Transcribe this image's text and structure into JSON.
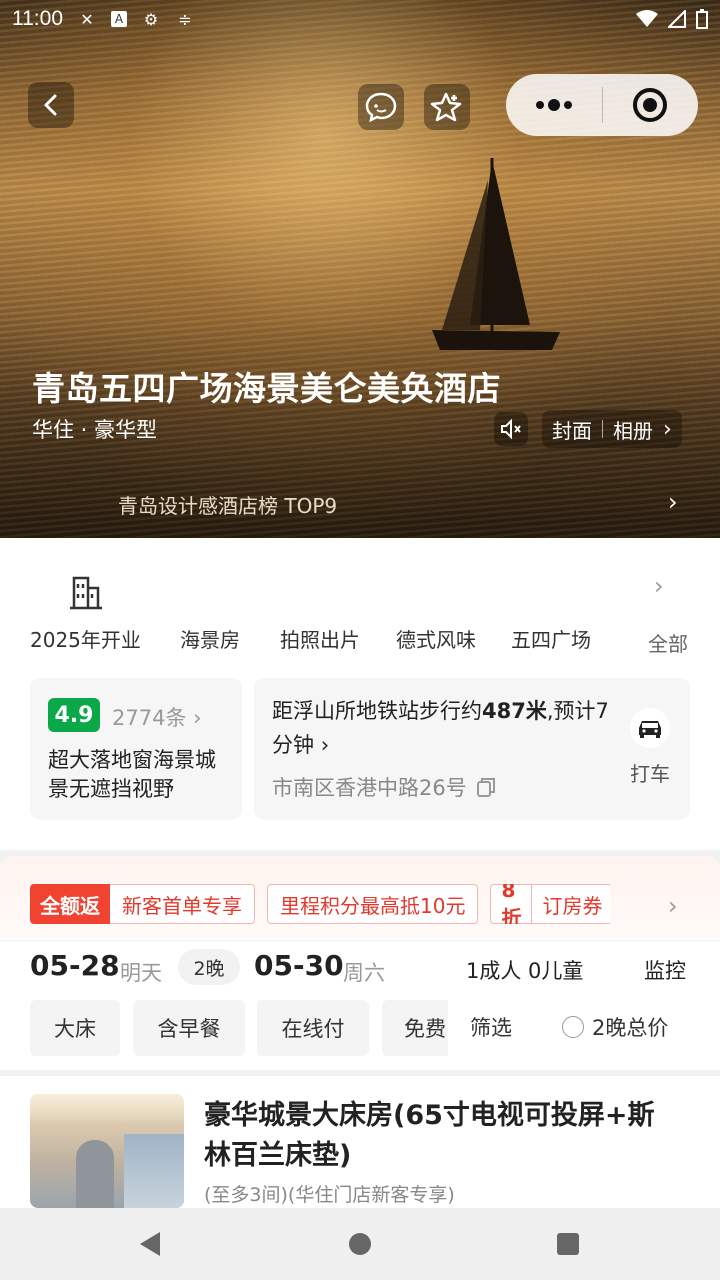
{
  "status_bar": {
    "time": "11:00"
  },
  "hero": {
    "hotel_name": "青岛五四广场海景美仑美奂酒店",
    "brand_type": "华住 · 豪华型",
    "cover_label": "封面",
    "album_label": "相册",
    "ranking_text": "青岛设计感酒店榜 TOP9"
  },
  "facilities": {
    "tags": [
      "2025年开业",
      "海景房",
      "拍照出片",
      "德式风味",
      "五四广场"
    ],
    "all_label": "全部"
  },
  "rating": {
    "score": "4.9",
    "review_count": "2774条",
    "highlight": "超大落地窗海景城景无遮挡视野"
  },
  "location": {
    "distance_prefix": "距浮山所地铁站步行约",
    "distance_value": "487米",
    "distance_suffix": ",预计7分钟",
    "address": "市南区香港中路26号",
    "taxi_label": "打车"
  },
  "promos": {
    "full_return_label": "全额返",
    "full_return_text": "新客首单专享",
    "points_text": "里程积分最高抵10元",
    "discount_label": "8折",
    "discount_text": "订房券"
  },
  "booking": {
    "checkin_date": "05-28",
    "checkin_day": "明天",
    "nights": "2晚",
    "checkout_date": "05-30",
    "checkout_day": "周六",
    "guests": "1成人 0儿童",
    "monitor_label": "监控"
  },
  "filters": {
    "chips": [
      "大床",
      "含早餐",
      "在线付",
      "免费"
    ],
    "filter_label": "筛选",
    "total_price_label": "2晚总价"
  },
  "room": {
    "title": "豪华城景大床房(65寸电视可投屏+斯林百兰床垫)",
    "note": "(至多3间)(华住门店新客专享)"
  },
  "colors": {
    "accent_red": "#e2392c",
    "score_green": "#0ba84a"
  }
}
